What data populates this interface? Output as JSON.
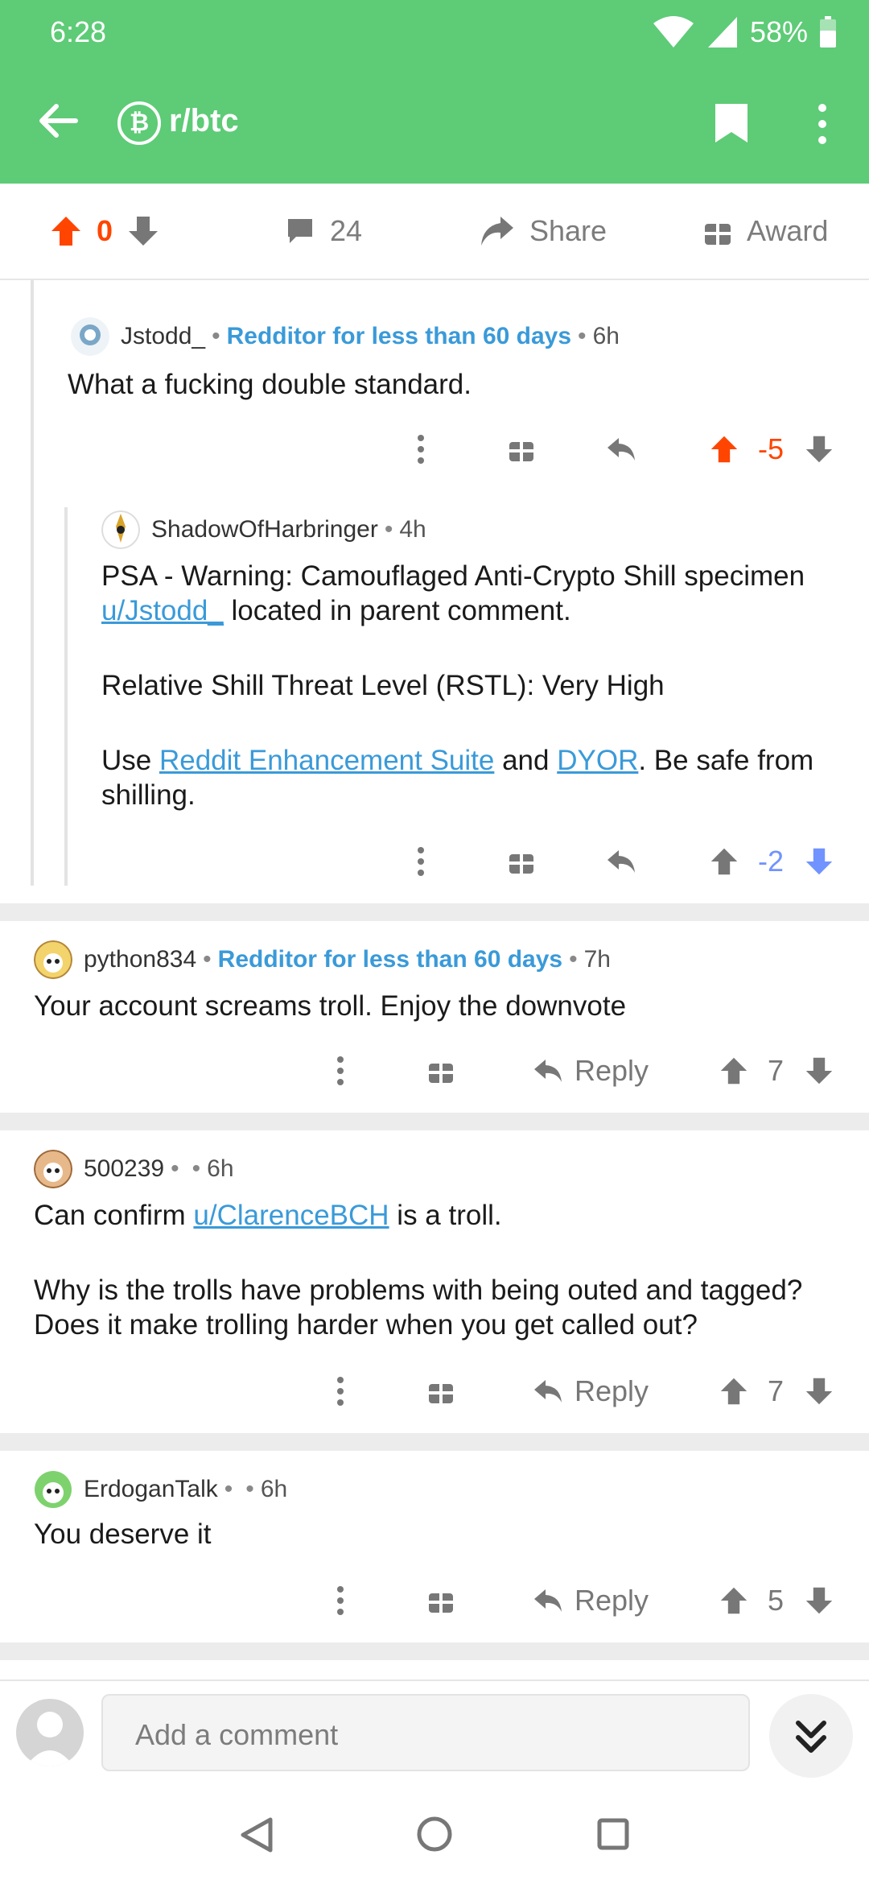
{
  "status": {
    "time": "6:28",
    "battery": "58%"
  },
  "appbar": {
    "subreddit": "r/btc",
    "sub_icon_letter": "₿"
  },
  "post_actions": {
    "score": "0",
    "comments": "24",
    "share_label": "Share",
    "award_label": "Award"
  },
  "comments": [
    {
      "author": "Jstodd_",
      "flair": "Redditor for less than 60 days",
      "time": "6h",
      "body": "What a fucking double standard.",
      "score": "-5"
    },
    {
      "author": "ShadowOfHarbringer",
      "time": "4h",
      "body_p1_pre": "PSA - Warning: Camouflaged Anti-Crypto Shill specimen",
      "body_p1_link": "u/Jstodd_",
      "body_p1_post": " located in parent comment.",
      "body_p2": "Relative Shill Threat Level (RSTL): Very High",
      "body_p3_pre": "Use ",
      "body_p3_link1": "Reddit Enhancement Suite",
      "body_p3_mid": " and ",
      "body_p3_link2": "DYOR",
      "body_p3_post": ". Be safe from shilling.",
      "score": "-2"
    },
    {
      "author": "python834",
      "flair": "Redditor for less than 60 days",
      "time": "7h",
      "body": "Your account screams troll. Enjoy the downvote",
      "reply_label": "Reply",
      "score": "7"
    },
    {
      "author": "500239",
      "time": "6h",
      "body_p1_pre": "Can confirm ",
      "body_p1_link": "u/ClarenceBCH",
      "body_p1_post": " is a troll.",
      "body_p2": "Why is the trolls have problems with being outed and tagged? Does it make trolling harder when you get called out?",
      "reply_label": "Reply",
      "score": "7"
    },
    {
      "author": "ErdoganTalk",
      "time": "6h",
      "body": "You deserve it",
      "reply_label": "Reply",
      "score": "5"
    }
  ],
  "composer": {
    "placeholder": "Add a comment"
  },
  "colors": {
    "brand_green": "#5ecb77",
    "upvote": "#ff4500",
    "downvote": "#7193ff",
    "link": "#3a9ad9"
  }
}
